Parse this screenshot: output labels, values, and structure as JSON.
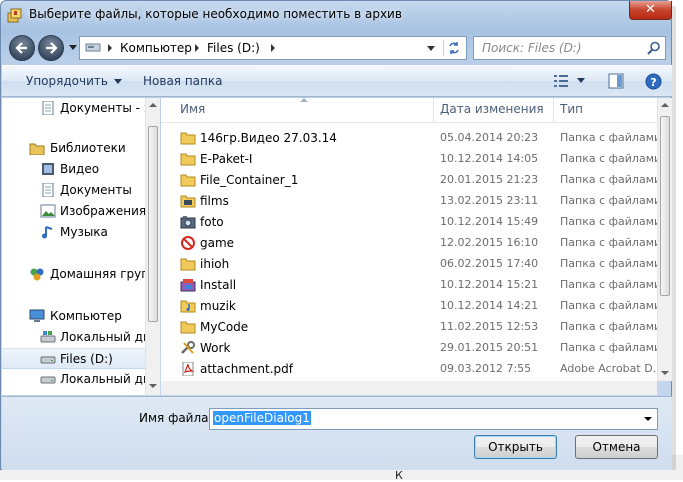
{
  "window": {
    "title": "Выберите файлы, которые необходимо поместить в архив",
    "close_glyph": "✕"
  },
  "address": {
    "crumbs": [
      "Компьютер",
      "Files (D:)"
    ]
  },
  "search": {
    "placeholder": "Поиск: Files (D:)"
  },
  "toolbar": {
    "organize_label": "Упорядочить",
    "new_folder_label": "Новая папка"
  },
  "nav": {
    "items": [
      {
        "label": "Документы - Я",
        "icon": "documents-icon"
      },
      {
        "label": "Библиотеки",
        "icon": "libraries-icon"
      },
      {
        "label": "Видео",
        "icon": "video-icon"
      },
      {
        "label": "Документы",
        "icon": "documents-icon"
      },
      {
        "label": "Изображения",
        "icon": "pictures-icon"
      },
      {
        "label": "Музыка",
        "icon": "music-icon"
      },
      {
        "label": "Домашняя групп",
        "icon": "homegroup-icon"
      },
      {
        "label": "Компьютер",
        "icon": "computer-icon"
      },
      {
        "label": "Локальный дис",
        "icon": "drive-system-icon"
      },
      {
        "label": "Files (D:)",
        "icon": "drive-icon",
        "selected": true
      },
      {
        "label": "Локальный дис",
        "icon": "drive-icon"
      }
    ]
  },
  "files": {
    "columns": [
      "Имя",
      "Дата изменения",
      "Тип"
    ],
    "rows": [
      {
        "name": "146гр.Видео 27.03.14",
        "date": "05.04.2014 20:23",
        "type": "Папка с файлами",
        "icon": "folder-icon"
      },
      {
        "name": "E-Paket-I",
        "date": "10.12.2014 14:05",
        "type": "Папка с файлами",
        "icon": "folder-icon"
      },
      {
        "name": "File_Container_1",
        "date": "20.01.2015 21:23",
        "type": "Папка с файлами",
        "icon": "folder-icon"
      },
      {
        "name": "films",
        "date": "13.02.2015 23:11",
        "type": "Папка с файлами",
        "icon": "video-folder-icon"
      },
      {
        "name": "foto",
        "date": "10.12.2014 15:49",
        "type": "Папка с файлами",
        "icon": "camera-folder-icon"
      },
      {
        "name": "game",
        "date": "12.02.2015 16:10",
        "type": "Папка с файлами",
        "icon": "no-entry-icon"
      },
      {
        "name": "ihioh",
        "date": "06.02.2015 17:40",
        "type": "Папка с файлами",
        "icon": "folder-icon"
      },
      {
        "name": "Install",
        "date": "10.12.2014 15:21",
        "type": "Папка с файлами",
        "icon": "installer-folder-icon"
      },
      {
        "name": "muzik",
        "date": "10.12.2014 14:21",
        "type": "Папка с файлами",
        "icon": "music-folder-icon"
      },
      {
        "name": "MyCode",
        "date": "11.02.2015 12:53",
        "type": "Папка с файлами",
        "icon": "folder-icon"
      },
      {
        "name": "Work",
        "date": "29.01.2015 20:51",
        "type": "Папка с файлами",
        "icon": "tools-folder-icon"
      },
      {
        "name": "attachment.pdf",
        "date": "09.03.2012 7:55",
        "type": "Adobe Acrobat D...",
        "icon": "pdf-icon"
      }
    ]
  },
  "filename": {
    "label": "Имя файла:",
    "value": "openFileDialog1"
  },
  "buttons": {
    "open_label": "Открыть",
    "cancel_label": "Отмена"
  },
  "background_text": "К"
}
